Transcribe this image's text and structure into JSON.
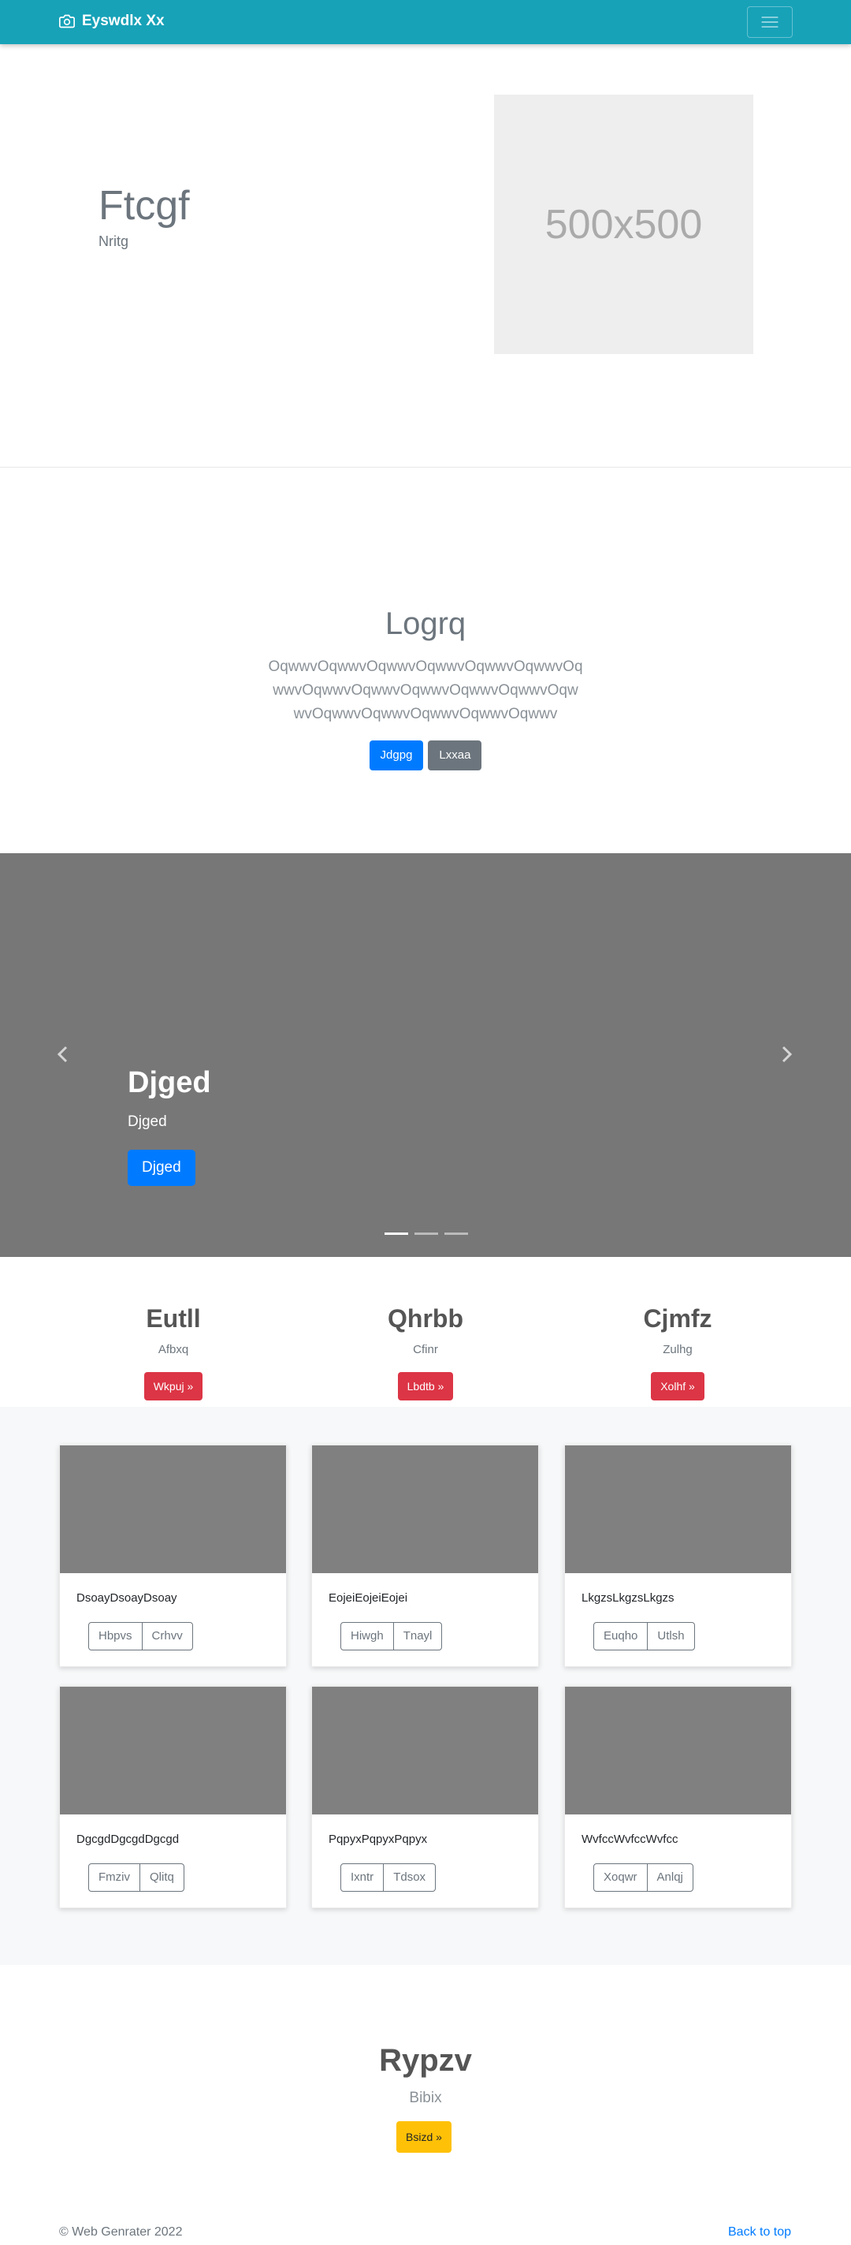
{
  "navbar": {
    "brand": "Eyswdlx Xx",
    "brand_icon": "camera-icon",
    "toggler_icon": "hamburger-icon",
    "color": "#17a2b8"
  },
  "hero": {
    "title": "Ftcgf",
    "subtitle": "Nritg",
    "image_text": "500x500"
  },
  "jumbotron": {
    "title": "Logrq",
    "lead": "OqwwvOqwwvOqwwvOqwwvOqwwvOqwwvOqwwvOqwwvOqwwvOqwwvOqwwvOqwwvOqwwvOqwwvOqwwvOqwwvOqwwvOqwwv",
    "primary_button": "Jdgpg",
    "secondary_button": "Lxxaa"
  },
  "carousel": {
    "caption_title": "Djged",
    "caption_text": "Djged",
    "caption_button": "Djged",
    "slides": 3,
    "active_index": 0,
    "background": "#777777"
  },
  "features": [
    {
      "title": "Eutll",
      "text": "Afbxq",
      "button": "Wkpuj »"
    },
    {
      "title": "Qhrbb",
      "text": "Cfinr",
      "button": "Lbdtb »"
    },
    {
      "title": "Cjmfz",
      "text": "Zulhg",
      "button": "Xolhf »"
    }
  ],
  "cards": [
    {
      "text": "DsoayDsoayDsoay",
      "buttons": [
        "Hbpvs",
        "Crhvv"
      ]
    },
    {
      "text": "EojeiEojeiEojei",
      "buttons": [
        "Hiwgh",
        "Tnayl"
      ]
    },
    {
      "text": "LkgzsLkgzsLkgzs",
      "buttons": [
        "Euqho",
        "Utlsh"
      ]
    },
    {
      "text": "DgcgdDgcgdDgcgd",
      "buttons": [
        "Fmziv",
        "Qlitq"
      ]
    },
    {
      "text": "PqpyxPqpyxPqpyx",
      "buttons": [
        "Ixntr",
        "Tdsox"
      ]
    },
    {
      "text": "WvfccWvfccWvfcc",
      "buttons": [
        "Xoqwr",
        "Anlqj"
      ]
    }
  ],
  "cta": {
    "title": "Rypzv",
    "subtitle": "Bibix",
    "button": "Bsizd »"
  },
  "footer": {
    "copyright": "© Web Genrater 2022",
    "back_to_top": "Back to top"
  }
}
